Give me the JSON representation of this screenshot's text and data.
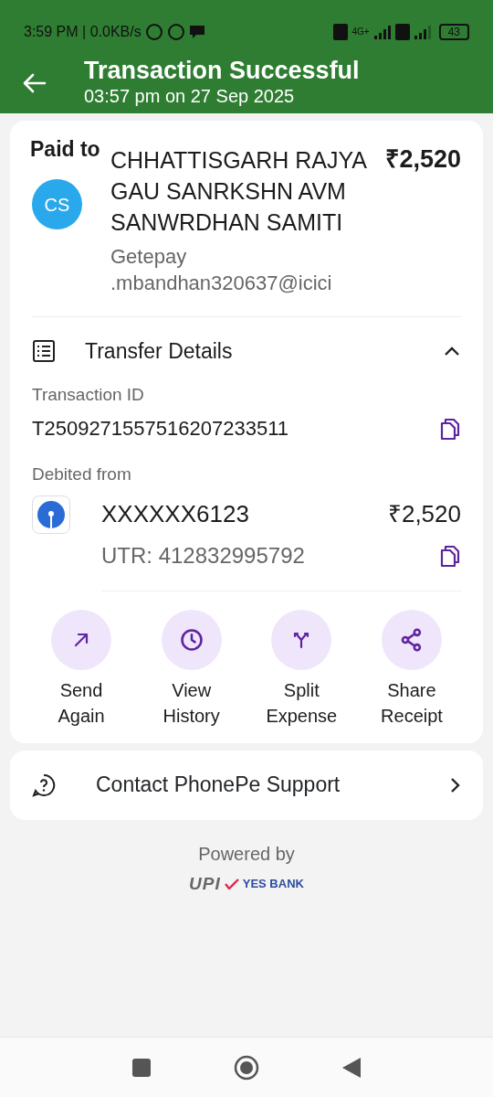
{
  "status_bar": {
    "time": "3:59 PM | 0.0KB/s",
    "network": "4G+",
    "battery": "43"
  },
  "header": {
    "title": "Transaction Successful",
    "subtitle": "03:57 pm on 27 Sep 2025"
  },
  "payee": {
    "label": "Paid to",
    "initials": "CS",
    "name": "CHHATTISGARH RAJYA GAU SANRKSHN AVM SANWRDHAN SAMITI",
    "upi_id": "Getepay .mbandhan320637@icici",
    "amount": "₹2,520"
  },
  "transfer": {
    "title": "Transfer Details",
    "expanded": true,
    "transaction_id_label": "Transaction ID",
    "transaction_id": "T2509271557516207233511",
    "debited_label": "Debited from",
    "account": "XXXXXX6123",
    "amount": "₹2,520",
    "utr": "UTR: 412832995792"
  },
  "actions": [
    {
      "kind": "send",
      "label": "Send Again"
    },
    {
      "kind": "history",
      "label": "View History"
    },
    {
      "kind": "split",
      "label": "Split Expense"
    },
    {
      "kind": "share",
      "label": "Share Receipt"
    }
  ],
  "support": {
    "label": "Contact PhonePe Support"
  },
  "footer": {
    "powered_by": "Powered by",
    "upi": "UPI",
    "bank": "YES BANK"
  }
}
